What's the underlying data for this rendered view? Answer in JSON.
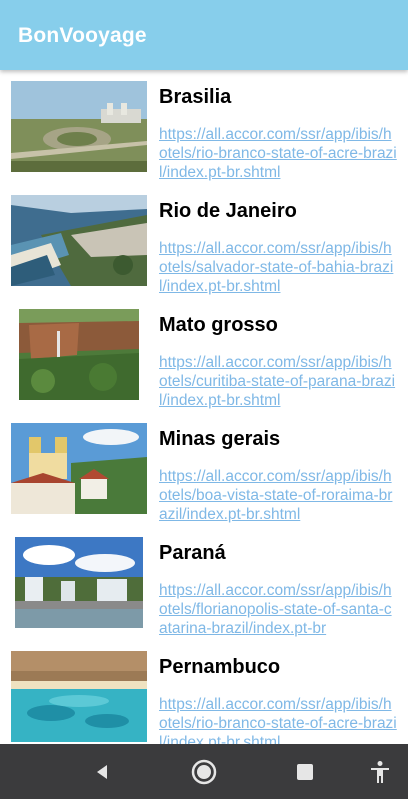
{
  "app": {
    "title": "BonVooyage"
  },
  "items": [
    {
      "name": "Brasilia",
      "link": "https://all.accor.com/ssr/app/ibis/hotels/rio-branco-state-of-acre-brazil/index.pt-br.shtml",
      "image": "brasilia-photo"
    },
    {
      "name": "Rio de Janeiro",
      "link": "https://all.accor.com/ssr/app/ibis/hotels/salvador-state-of-bahia-brazil/index.pt-br.shtml",
      "image": "rio-photo"
    },
    {
      "name": "Mato grosso",
      "link": "https://all.accor.com/ssr/app/ibis/hotels/curitiba-state-of-parana-brazil/index.pt-br.shtml",
      "image": "mato-grosso-photo"
    },
    {
      "name": "Minas gerais",
      "link": "https://all.accor.com/ssr/app/ibis/hotels/boa-vista-state-of-roraima-brazil/index.pt-br.shtml",
      "image": "minas-gerais-photo"
    },
    {
      "name": "Paraná",
      "link": "https://all.accor.com/ssr/app/ibis/hotels/florianopolis-state-of-santa-catarina-brazil/index.pt-br",
      "image": "parana-photo"
    },
    {
      "name": "Pernambuco",
      "link": "https://all.accor.com/ssr/app/ibis/hotels/rio-branco-state-of-acre-brazil/index.pt-br.shtml",
      "image": "pernambuco-photo"
    }
  ],
  "navbar": {
    "icons": [
      "back-icon",
      "home-icon",
      "recents-icon",
      "accessibility-icon"
    ]
  }
}
